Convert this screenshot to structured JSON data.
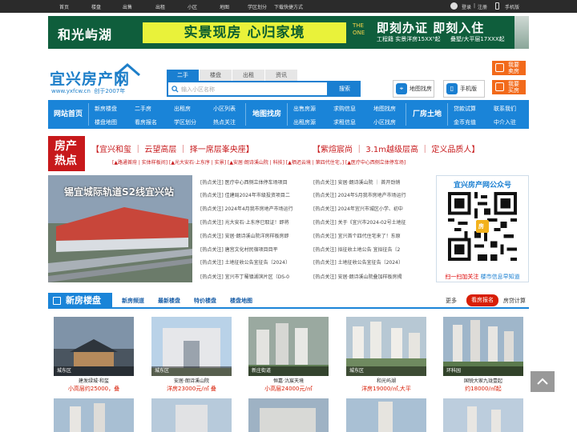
{
  "topbar": {
    "links": [
      "首页",
      "楼盘",
      "出售",
      "出租",
      "小区",
      "地图",
      "学区划分",
      "下载快捷方式"
    ],
    "login": "登录",
    "sep": "|",
    "register": "注册",
    "mobile": "手机版"
  },
  "banner": {
    "brand": "和光屿湖",
    "slogan": "实景现房 心归家境",
    "the_one": "THE ONE",
    "headline": "即刻办证 即刻入住",
    "detail1": "工程籍 实景洋房15XX⁵起",
    "detail2": "叠墅/大平层17XXX起"
  },
  "logo": {
    "name": "宜兴房产网",
    "url": "www.yxfcw.cn",
    "since": "创于2007年"
  },
  "search": {
    "tabs": [
      "二手",
      "楼盘",
      "出租",
      "资讯"
    ],
    "placeholder": "输入小区名称",
    "button": "搜索"
  },
  "services": {
    "map": "地图找房",
    "mobile": "手机版",
    "sell": "我要卖房",
    "buy": "我要买房"
  },
  "nav": {
    "home": "网站首页",
    "col1": [
      "新房楼盘",
      "楼盘地图"
    ],
    "col2": [
      "二手房",
      "看房报名"
    ],
    "col3": [
      "出租房",
      "学区划分"
    ],
    "col4": [
      "小区列表",
      "热点关注"
    ],
    "map_head": "地图找房",
    "col5": [
      "出售房源",
      "出租房源"
    ],
    "col6": [
      "求购信息",
      "求租信息"
    ],
    "col7": [
      "地图找房",
      "小区找房"
    ],
    "land_head": "厂房土地",
    "col8": [
      "贷款试算",
      "金币充值"
    ],
    "col9": [
      "联系我们",
      "中介入驻"
    ]
  },
  "hot": {
    "label_top": "房产",
    "label_bottom": "热点",
    "line1": [
      "【宜兴和玺 ｜ 云望高层 ｜ 择一席层峯央座】",
      "【紫煊宸尚 ｜ 3.1m越级层高 ｜ 定义品质人】"
    ],
    "line2": "[▲路通首府 | 实体样板间] [▲光大安石·上东序 | 实景] [▲安居·朗诗溪山院 | 科技] [▲栖迟云境 | 第四代住宅，] [▲医疗中心西侧立体停车场]"
  },
  "feature": {
    "caption": "锡宜城际轨道S2线宜兴站"
  },
  "news_left": [
    "[热点关注] 医疗中心西侧立体停车场项目",
    "[热点关注] 佳建局2024年市级投资项目二",
    "[热点关注] 2024年4月我市房地产市场运行",
    "[热点关注] 光大安石·上东序已取证！即将",
    "[热点关注] 安居·朗诗溪山院洋房样板房即",
    "[热点关注] 唐宫文化村民宿项目目平",
    "[热点关注] 土地征收公告宜征告〔2024〕",
    "[热点关注] 宜兴市丁蜀镇湖滨片区（DS-0"
  ],
  "news_right": [
    "[热点关注] 安居·朗诗溪山院 ｜ 首开劲销",
    "[热点关注] 2024年5月我市房地产市场运行",
    "[热点关注] 2024年宜兴市城区小学、初中",
    "[热点关注] 关于《宜兴市2024-02号土地征",
    "[热点关注] 宜兴首个四代住宅来了！东原",
    "[热点关注] 拟征收土地公告 宜拟征告〔2",
    "[热点关注] 土地征收公告宜征告〔2024〕",
    "[热点关注] 安居·朗诗溪山院叠加样板房揭"
  ],
  "qr": {
    "title": "宜兴房产网公众号",
    "badge": "房",
    "bottom1": "扫一扫加关注",
    "bottom2": "楼市信息早知道"
  },
  "section": {
    "title": "新房楼盘",
    "links": [
      "新房频道",
      "最新楼盘",
      "特价楼盘",
      "楼盘地图"
    ],
    "more": "更多",
    "signup": "看房报名",
    "calc": "房贷计算"
  },
  "cards": [
    {
      "area": "城东区",
      "name": "建发绿城·和玺",
      "price": "小高层约25000，叠"
    },
    {
      "area": "城东区",
      "name": "安居·朗诗溪山院",
      "price": "洋房23000元/㎡ 叠"
    },
    {
      "area": "新庄街道",
      "name": "恒嘉·氿宸天境",
      "price": "小高层24000元/㎡"
    },
    {
      "area": "城东区",
      "name": "和光屿湖",
      "price": "洋房19000/㎡,大平"
    },
    {
      "area": "环科园",
      "name": "国锐大家九珑壹起",
      "price": "约18000/㎡起"
    }
  ],
  "colors": {
    "brand": "#1a84d8",
    "hot": "#c7191b",
    "orange": "#f26a1b"
  }
}
